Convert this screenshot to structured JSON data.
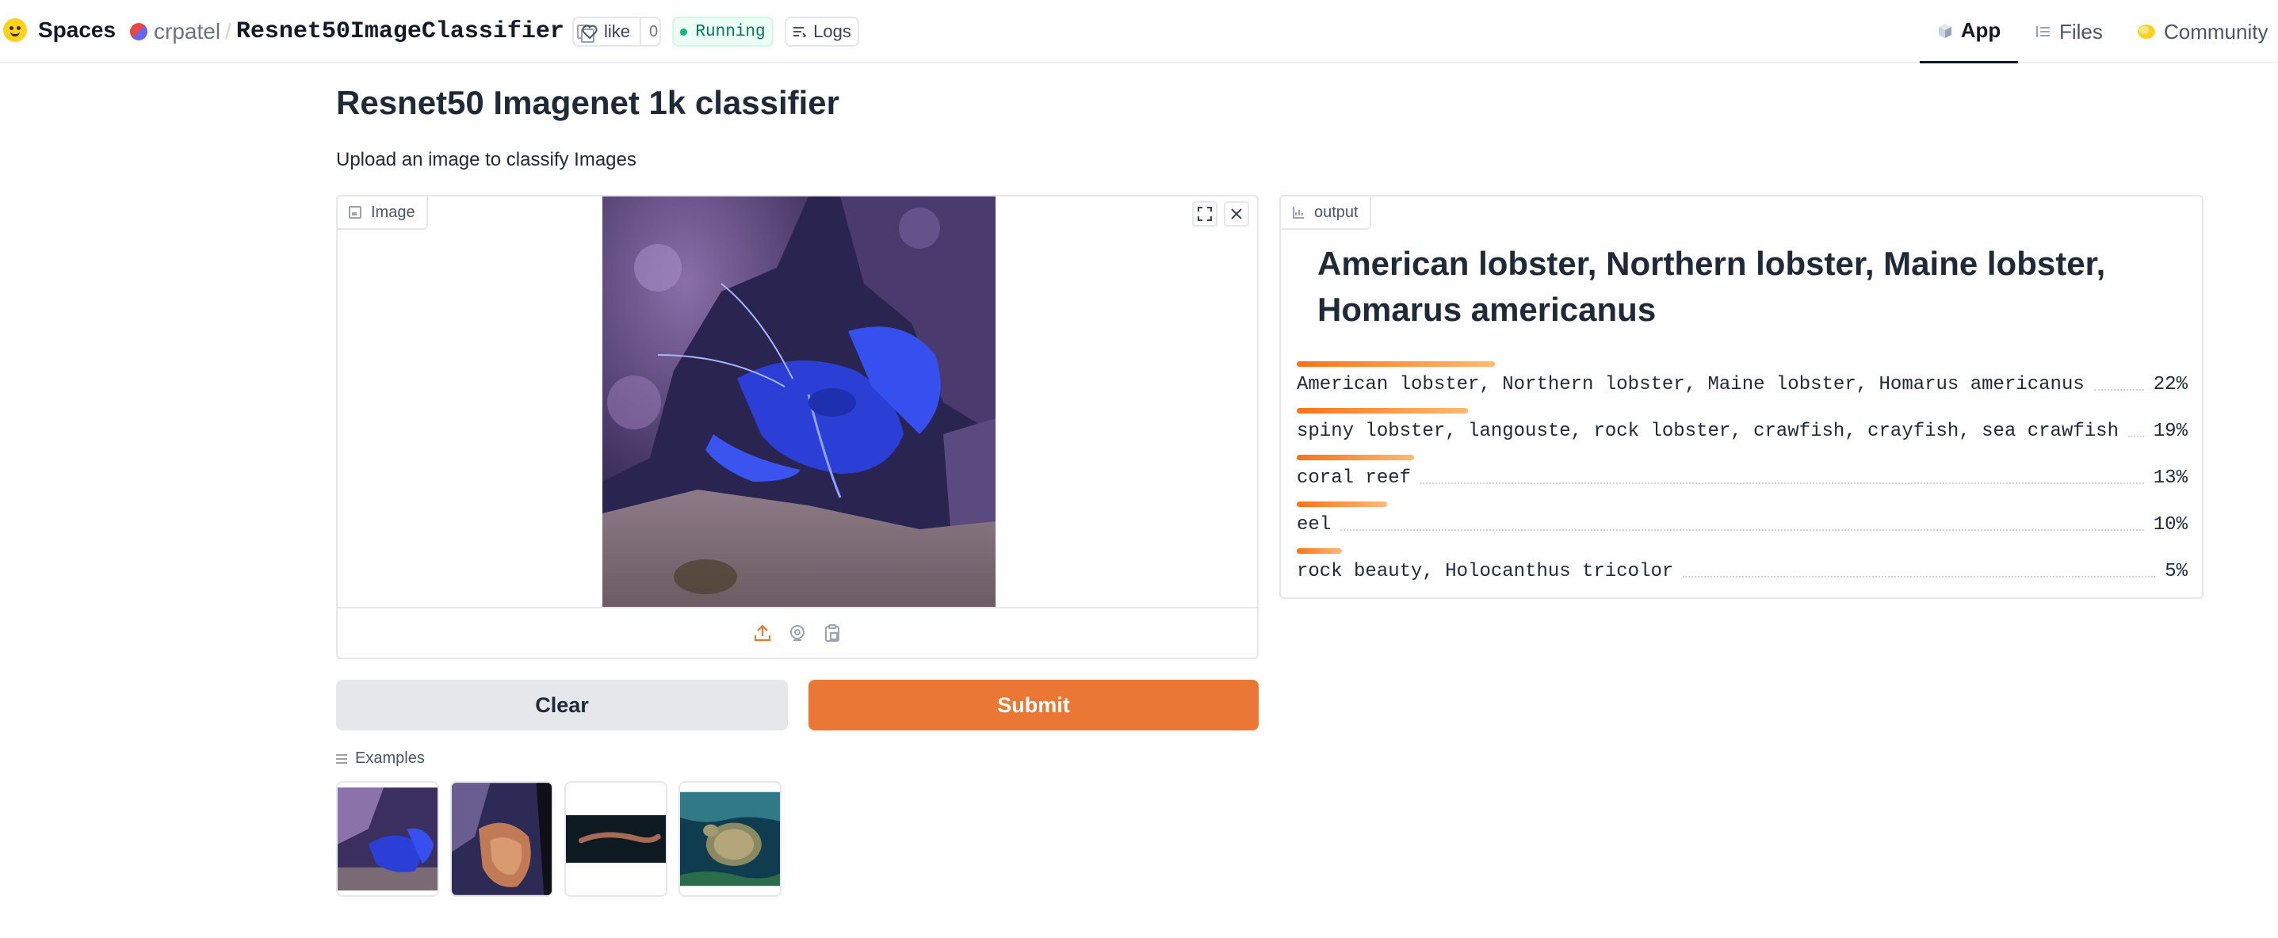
{
  "topbar": {
    "brand": "Spaces",
    "owner": "crpatel",
    "separator": "/",
    "repo_name": "Resnet50ImageClassifier",
    "like_label": "like",
    "like_count": "0",
    "status": "Running",
    "logs_label": "Logs",
    "tabs": [
      {
        "label": "App",
        "active": true
      },
      {
        "label": "Files",
        "active": false
      },
      {
        "label": "Community",
        "active": false
      }
    ]
  },
  "main": {
    "title": "Resnet50 Imagenet 1k classifier",
    "description": "Upload an image to classify Images",
    "input_label": "Image",
    "output_label": "output",
    "prediction": "American lobster, Northern lobster, Maine lobster, Homarus americanus",
    "confidences": [
      {
        "label": "American lobster, Northern lobster, Maine lobster, Homarus americanus",
        "percent": "22%",
        "value": 0.22
      },
      {
        "label": "spiny lobster, langouste, rock lobster, crawfish, crayfish, sea crawfish",
        "percent": "19%",
        "value": 0.19
      },
      {
        "label": "coral reef",
        "percent": "13%",
        "value": 0.13
      },
      {
        "label": "eel",
        "percent": "10%",
        "value": 0.1
      },
      {
        "label": "rock beauty, Holocanthus tricolor",
        "percent": "5%",
        "value": 0.05
      }
    ],
    "clear_label": "Clear",
    "submit_label": "Submit",
    "examples_label": "Examples"
  },
  "colors": {
    "accent": "#ea7734",
    "status_green": "#10b981",
    "bar_start": "#f97316",
    "bar_end": "#fdba74"
  },
  "icons": [
    "huggingface-logo",
    "copy-icon",
    "heart-icon",
    "logs-icon",
    "app-cube-icon",
    "files-icon",
    "community-icon",
    "image-icon",
    "fullscreen-icon",
    "close-icon",
    "upload-icon",
    "webcam-icon",
    "clipboard-icon",
    "chart-icon",
    "list-icon"
  ]
}
